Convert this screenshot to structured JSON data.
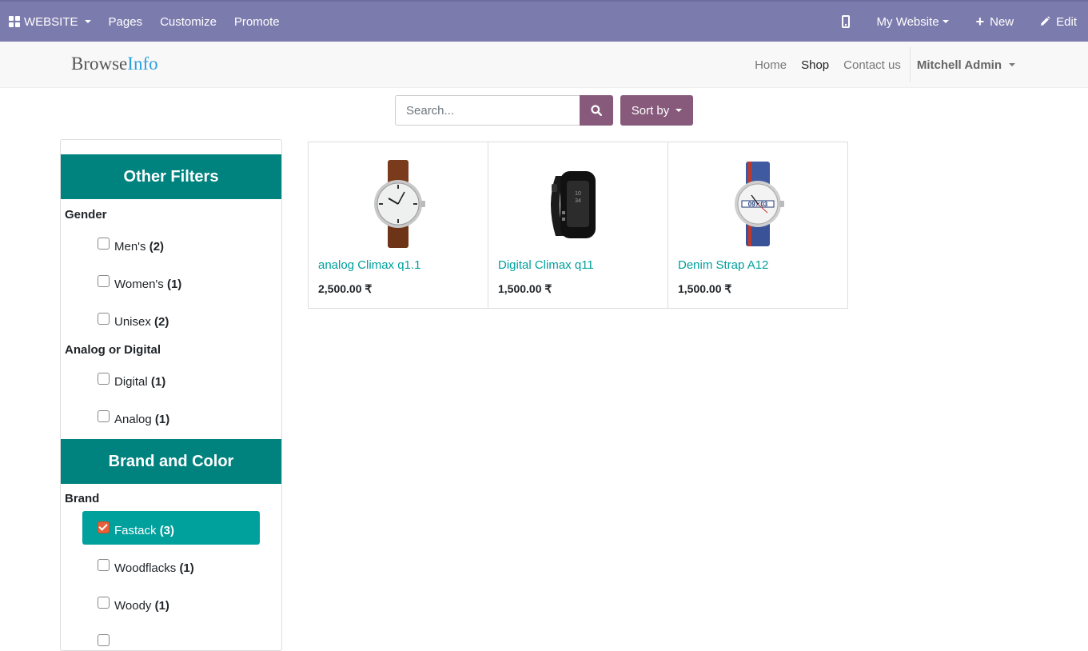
{
  "admin_bar": {
    "website_label": "WEBSITE",
    "menu": [
      "Pages",
      "Customize",
      "Promote"
    ],
    "my_website_label": "My Website",
    "new_label": "New",
    "edit_label": "Edit",
    "bar_color": "#7c7bad"
  },
  "header": {
    "logo_part1": "Browse",
    "logo_part2": "Info",
    "nav": [
      "Home",
      "Shop",
      "Contact us"
    ],
    "active_nav": "Shop",
    "user_name": "Mitchell Admin"
  },
  "search": {
    "placeholder": "Search...",
    "sort_label": "Sort by",
    "button_color": "#875a7b"
  },
  "filters": {
    "sections": [
      {
        "title": "Other Filters",
        "groups": [
          {
            "label": "Gender",
            "options": [
              {
                "name": "Men's",
                "count": "(2)",
                "checked": false
              },
              {
                "name": "Women's",
                "count": "(1)",
                "checked": false
              },
              {
                "name": "Unisex",
                "count": "(2)",
                "checked": false
              }
            ]
          },
          {
            "label": "Analog or Digital",
            "options": [
              {
                "name": "Digital",
                "count": "(1)",
                "checked": false
              },
              {
                "name": "Analog",
                "count": "(1)",
                "checked": false
              }
            ]
          }
        ]
      },
      {
        "title": "Brand and Color",
        "groups": [
          {
            "label": "Brand",
            "options": [
              {
                "name": "Fastack",
                "count": "(3)",
                "checked": true
              },
              {
                "name": "Woodflacks",
                "count": "(1)",
                "checked": false
              },
              {
                "name": "Woody",
                "count": "(1)",
                "checked": false
              }
            ]
          }
        ]
      }
    ],
    "header_color": "#00837f",
    "selected_color": "#00a09d"
  },
  "products": [
    {
      "name": "analog Climax q1.1",
      "price": "2,500.00 ₹",
      "icon": "analog-watch-brown-strap-icon"
    },
    {
      "name": "Digital Climax q11",
      "price": "1,500.00 ₹",
      "icon": "digital-band-watch-icon"
    },
    {
      "name": "Denim Strap A12",
      "price": "1,500.00 ₹",
      "icon": "denim-strap-watch-icon"
    }
  ]
}
